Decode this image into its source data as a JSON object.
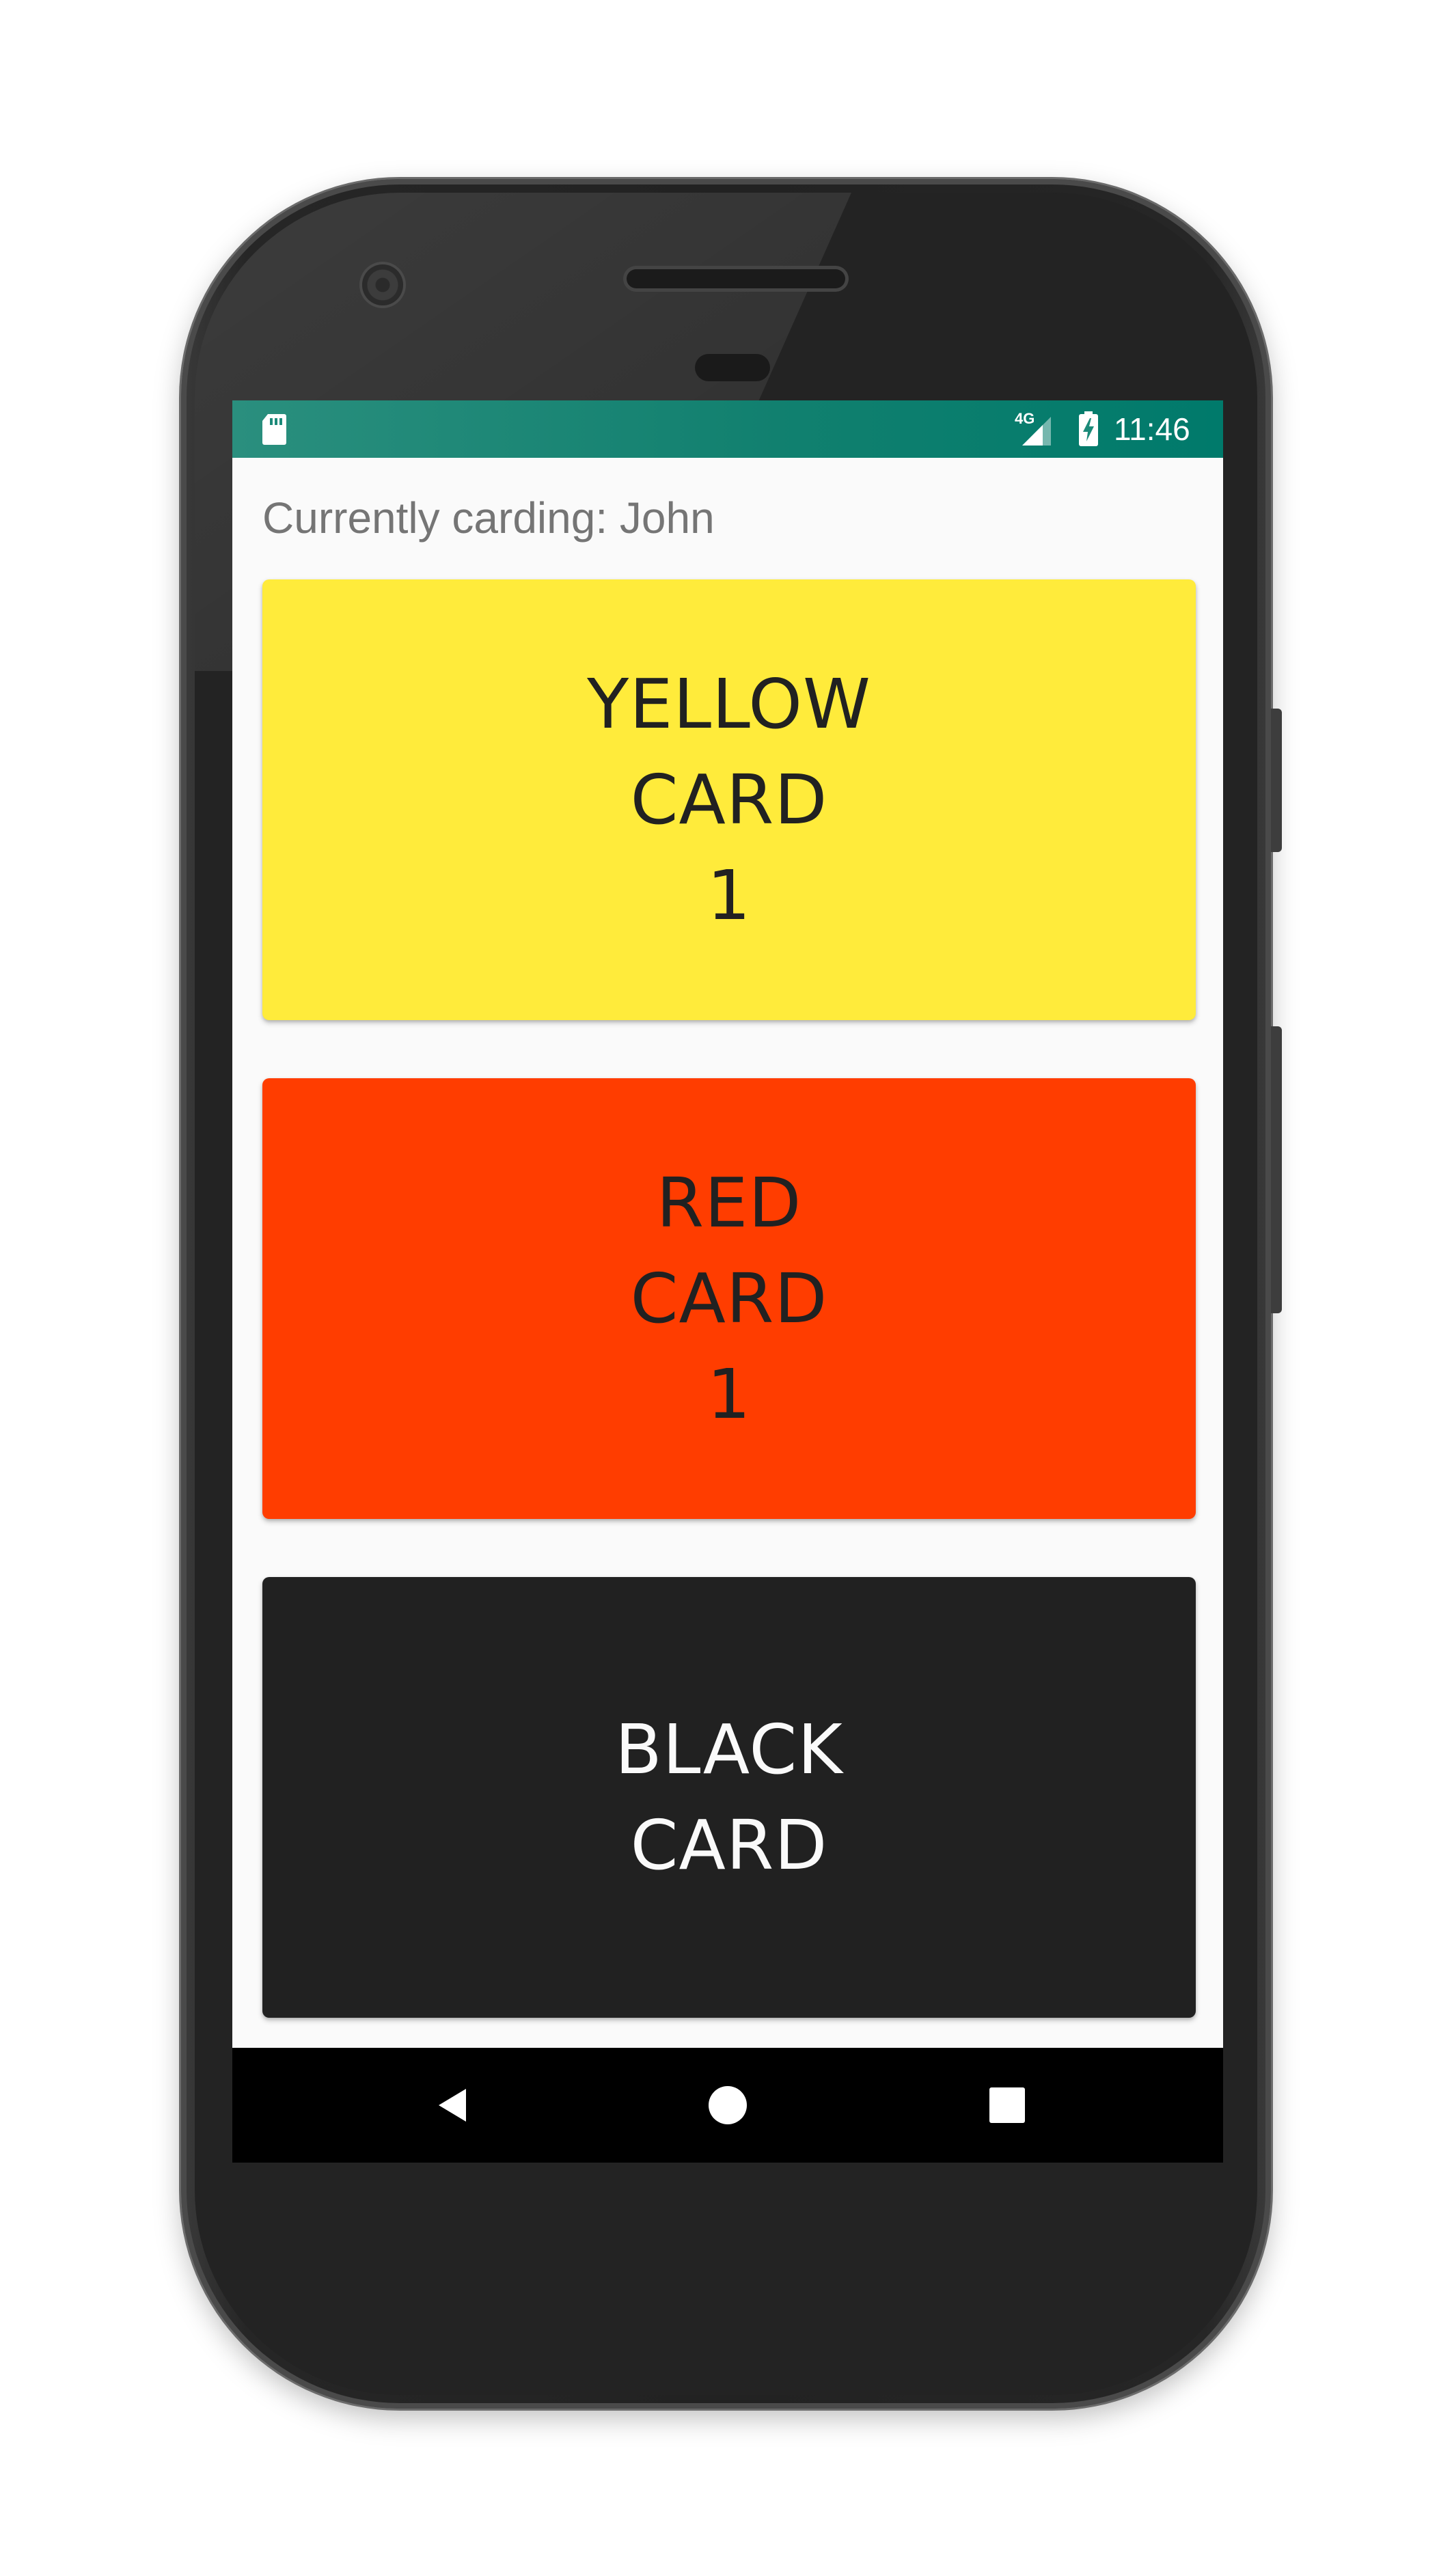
{
  "status_bar": {
    "network_type": "4G",
    "time": "11:46",
    "icons": [
      "sd-card-icon",
      "cell-signal-icon",
      "battery-charging-icon"
    ],
    "color": "#1b8a79"
  },
  "header": {
    "currently_carding": "Currently carding: John"
  },
  "cards": {
    "yellow": {
      "line1": "YELLOW",
      "line2": "CARD",
      "count": "1",
      "color": "#ffeb3b"
    },
    "red": {
      "line1": "RED",
      "line2": "CARD",
      "count": "1",
      "color": "#ff3d00"
    },
    "black": {
      "line1": "BLACK",
      "line2": "CARD",
      "color": "#212121"
    }
  },
  "nav_bar": {
    "icons": [
      "back-icon",
      "home-icon",
      "recents-icon"
    ]
  }
}
